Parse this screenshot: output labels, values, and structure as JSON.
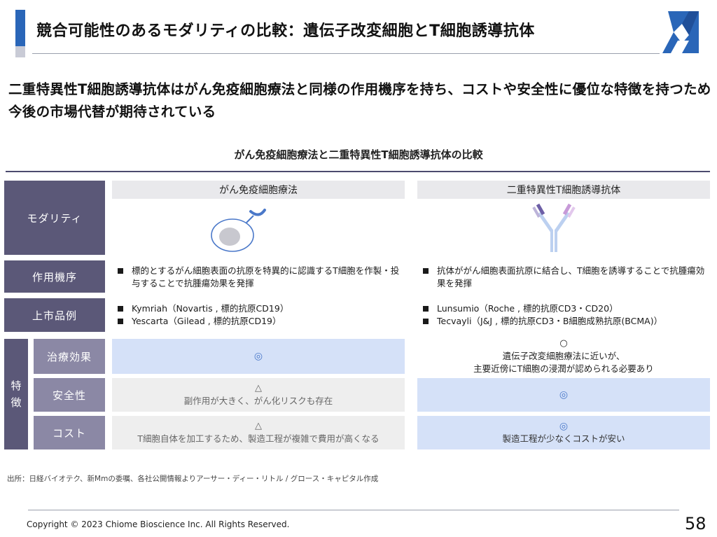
{
  "header": {
    "title": "競合可能性のあるモダリティの比較：遺伝子改変細胞とT細胞誘導抗体",
    "logo": "company-logo-icon"
  },
  "lead": "二重特異性T細胞誘導抗体はがん免疫細胞療法と同様の作用機序を持ち、コストや安全性に優位な特徴を持つため今後の市場代替が期待されている",
  "table": {
    "title": "がん免疫細胞療法と二重特異性T細胞誘導抗体の比較",
    "columns": [
      "がん免疫細胞療法",
      "二重特異性T細胞誘導抗体"
    ],
    "rows": {
      "modality": "モダリティ",
      "mechanism": {
        "label": "作用機序",
        "left": "標的とするがん細胞表面の抗原を特異的に認識するT細胞を作製・投与することで抗腫瘍効果を発揮",
        "right": "抗体ががん細胞表面抗原に結合し、T細胞を誘導することで抗腫瘍効果を発揮"
      },
      "examples": {
        "label": "上市品例",
        "left": [
          "Kymriah（Novartis , 標的抗原CD19）",
          "Yescarta（Gilead , 標的抗原CD19）"
        ],
        "right": [
          "Lunsumio（Roche , 標的抗原CD3・CD20）",
          "Tecvayli（J&J , 標的抗原CD3・B細胞成熟抗原(BCMA)）"
        ]
      },
      "features": {
        "label_1": "特",
        "label_2": "徴",
        "efficacy": {
          "label": "治療効果",
          "left_mark": "◎",
          "right_mark": "○",
          "right_line1": "遺伝子改変細胞療法に近いが、",
          "right_line2": "主要近傍にT細胞の浸潤が認められる必要あり"
        },
        "safety": {
          "label": "安全性",
          "left_mark": "△",
          "left_text": "副作用が大きく、がん化リスクも存在",
          "right_mark": "◎"
        },
        "cost": {
          "label": "コスト",
          "left_mark": "△",
          "left_text": "T細胞自体を加工するため、製造工程が複雑で費用が高くなる",
          "right_mark": "◎",
          "right_text": "製造工程が少なくコストが安い"
        }
      }
    }
  },
  "source": "出所：日経バイオテク、新Mmの委嘱、各社公開情報よりアーサー・ディー・リトル / グロース・キャピタル作成",
  "footer": {
    "copyright": "Copyright © 2023 Chiome Bioscience Inc. All Rights Reserved.",
    "page_number": "58"
  }
}
